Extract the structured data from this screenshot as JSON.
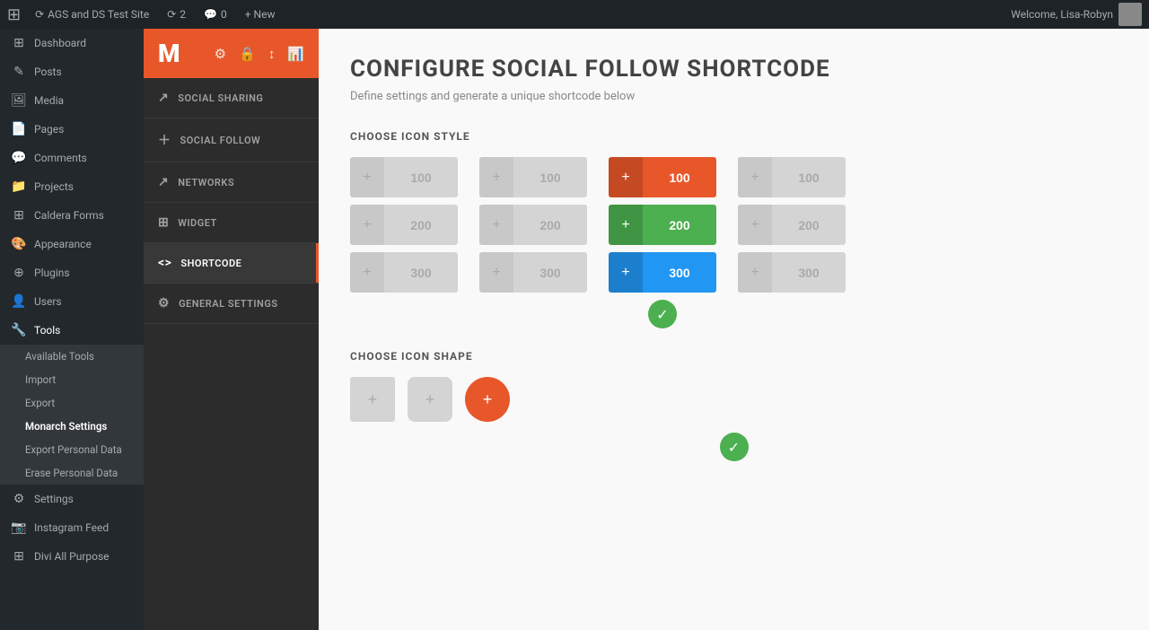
{
  "adminBar": {
    "logo": "W",
    "siteIcon": "⟳",
    "siteName": "AGS and DS Test Site",
    "updates": "2",
    "commentsIcon": "💬",
    "commentsCount": "0",
    "newLabel": "+ New",
    "welcome": "Welcome, Lisa-Robyn"
  },
  "sidebar": {
    "items": [
      {
        "id": "dashboard",
        "label": "Dashboard",
        "icon": "⊞"
      },
      {
        "id": "posts",
        "label": "Posts",
        "icon": "✎"
      },
      {
        "id": "media",
        "label": "Media",
        "icon": "🖼"
      },
      {
        "id": "pages",
        "label": "Pages",
        "icon": "📄"
      },
      {
        "id": "comments",
        "label": "Comments",
        "icon": "💬"
      },
      {
        "id": "projects",
        "label": "Projects",
        "icon": "📁"
      },
      {
        "id": "caldera-forms",
        "label": "Caldera Forms",
        "icon": "⊞"
      },
      {
        "id": "appearance",
        "label": "Appearance",
        "icon": "🎨"
      },
      {
        "id": "plugins",
        "label": "Plugins",
        "icon": "⊕"
      },
      {
        "id": "users",
        "label": "Users",
        "icon": "👤"
      },
      {
        "id": "tools",
        "label": "Tools",
        "icon": "🔧"
      },
      {
        "id": "settings",
        "label": "Settings",
        "icon": "⚙"
      },
      {
        "id": "instagram-feed",
        "label": "Instagram Feed",
        "icon": "📷"
      },
      {
        "id": "divi-all-purpose",
        "label": "Divi All Purpose",
        "icon": "⊞"
      }
    ],
    "submenu": {
      "tools": [
        {
          "id": "available-tools",
          "label": "Available Tools"
        },
        {
          "id": "import",
          "label": "Import"
        },
        {
          "id": "export",
          "label": "Export"
        },
        {
          "id": "monarch-settings",
          "label": "Monarch Settings",
          "active": true
        },
        {
          "id": "export-personal",
          "label": "Export Personal Data"
        },
        {
          "id": "erase-personal",
          "label": "Erase Personal Data"
        }
      ]
    }
  },
  "pluginNav": {
    "headerTitle": "M",
    "headerIcons": [
      "⚙",
      "🔒",
      "↕",
      "📊"
    ],
    "items": [
      {
        "id": "social-sharing",
        "label": "Social Sharing",
        "icon": "↗"
      },
      {
        "id": "social-follow",
        "label": "Social Follow",
        "icon": "+"
      },
      {
        "id": "networks",
        "label": "Networks",
        "icon": "↗"
      },
      {
        "id": "widget",
        "label": "Widget",
        "icon": "⊞"
      },
      {
        "id": "shortcode",
        "label": "Shortcode",
        "icon": "<>"
      },
      {
        "id": "general-settings",
        "label": "General Settings",
        "icon": "⚙"
      }
    ]
  },
  "content": {
    "title": "Configure Social Follow Shortcode",
    "subtitle": "Define settings and generate a unique shortcode below",
    "iconStyleSection": {
      "heading": "Choose Icon Style",
      "columns": [
        {
          "id": "col1",
          "buttons": [
            {
              "count": "100",
              "active": false
            },
            {
              "count": "200",
              "active": false
            },
            {
              "count": "300",
              "active": false
            }
          ]
        },
        {
          "id": "col2",
          "buttons": [
            {
              "count": "100",
              "active": false
            },
            {
              "count": "200",
              "active": false
            },
            {
              "count": "300",
              "active": false
            }
          ]
        },
        {
          "id": "col3-selected",
          "buttons": [
            {
              "count": "100",
              "active": true,
              "colorClass": "col-red-100"
            },
            {
              "count": "200",
              "active": true,
              "colorClass": "col-green-200"
            },
            {
              "count": "300",
              "active": true,
              "colorClass": "col-blue-300"
            }
          ]
        },
        {
          "id": "col4",
          "buttons": [
            {
              "count": "100",
              "active": false
            },
            {
              "count": "200",
              "active": false
            },
            {
              "count": "300",
              "active": false
            }
          ]
        }
      ]
    },
    "iconShapeSection": {
      "heading": "Choose Icon Shape",
      "shapes": [
        {
          "id": "square",
          "type": "square",
          "icon": "+"
        },
        {
          "id": "rounded",
          "type": "rounded",
          "icon": "+"
        },
        {
          "id": "circle",
          "type": "circle",
          "icon": "+",
          "selected": true
        }
      ]
    }
  }
}
